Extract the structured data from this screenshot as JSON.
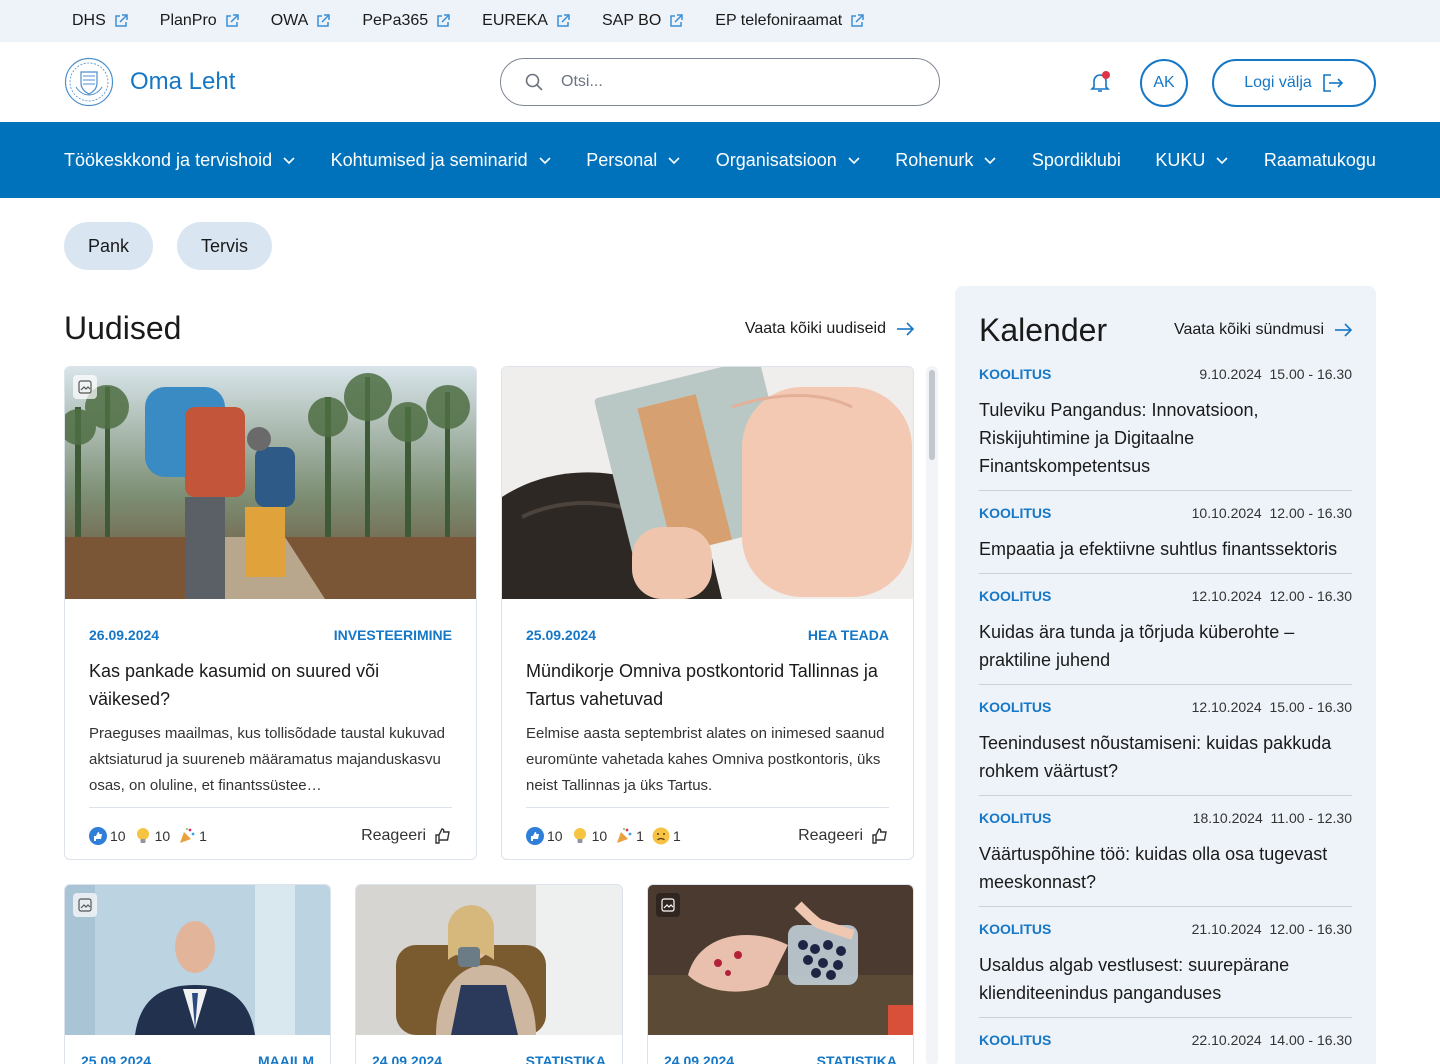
{
  "toplinks": [
    "DHS",
    "PlanPro",
    "OWA",
    "PePa365",
    "EUREKA",
    "SAP BO",
    "EP telefoniraamat"
  ],
  "header": {
    "brand": "Oma Leht",
    "search_placeholder": "Otsi...",
    "avatar_initials": "AK",
    "logout_label": "Logi välja"
  },
  "nav": [
    {
      "label": "Töökeskkond ja tervishoid",
      "dropdown": true
    },
    {
      "label": "Kohtumised ja seminarid",
      "dropdown": true
    },
    {
      "label": "Personal",
      "dropdown": true
    },
    {
      "label": "Organisatsioon",
      "dropdown": true
    },
    {
      "label": "Rohenurk",
      "dropdown": true
    },
    {
      "label": "Spordiklubi",
      "dropdown": false
    },
    {
      "label": "KUKU",
      "dropdown": true
    },
    {
      "label": "Raamatukogu",
      "dropdown": false
    }
  ],
  "chips": [
    "Pank",
    "Tervis"
  ],
  "news": {
    "title": "Uudised",
    "see_all": "Vaata kõiki uudiseid",
    "reply_label": "Reageeri",
    "cards": [
      {
        "date": "26.09.2024",
        "category": "INVESTEERIMINE",
        "title": "Kas pankade kasumid on suured või väikesed?",
        "text": "Praeguses maailmas, kus tollisõdade taustal kukuvad aktsiaturud ja suureneb määramatus majanduskasvu osas, on oluline, et finantssüstee…",
        "reactions": [
          {
            "icon": "thumbs-up-emoji",
            "count": "10"
          },
          {
            "icon": "lightbulb-emoji",
            "count": "10"
          },
          {
            "icon": "party-popper-emoji",
            "count": "1"
          }
        ]
      },
      {
        "date": "25.09.2024",
        "category": "HEA TEADA",
        "title": "Mündikorje Omniva postkontorid Tallinnas ja Tartus vahetuvad",
        "text": "Eelmise aasta septembrist alates on inimesed saanud euromünte vahetada kahes Omniva postkontoris, üks neist Tallinnas ja üks Tartus.",
        "reactions": [
          {
            "icon": "thumbs-up-emoji",
            "count": "10"
          },
          {
            "icon": "lightbulb-emoji",
            "count": "10"
          },
          {
            "icon": "party-popper-emoji",
            "count": "1"
          },
          {
            "icon": "sad-face-emoji",
            "count": "1"
          }
        ]
      },
      {
        "date": "25.09.2024",
        "category": "MAAILM"
      },
      {
        "date": "24.09.2024",
        "category": "STATISTIKA"
      },
      {
        "date": "24.09.2024",
        "category": "STATISTIKA"
      }
    ]
  },
  "calendar": {
    "title": "Kalender",
    "see_all": "Vaata kõiki sündmusi",
    "events": [
      {
        "tag": "KOOLITUS",
        "datetime": "9.10.2024  15.00 - 16.30",
        "title": "Tuleviku Pangandus: Innovatsioon, Riskijuhtimine ja Digitaalne Finantskompetentsus"
      },
      {
        "tag": "KOOLITUS",
        "datetime": "10.10.2024  12.00 - 16.30",
        "title": "Empaatia ja efektiivne suhtlus finantssektoris"
      },
      {
        "tag": "KOOLITUS",
        "datetime": "12.10.2024  12.00 - 16.30",
        "title": "Kuidas ära tunda ja tõrjuda küberohte – praktiline juhend"
      },
      {
        "tag": "KOOLITUS",
        "datetime": "12.10.2024  15.00 - 16.30",
        "title": "Teenindusest nõustamiseni: kuidas pakkuda rohkem väärtust?"
      },
      {
        "tag": "KOOLITUS",
        "datetime": "18.10.2024  11.00 - 12.30",
        "title": "Väärtuspõhine töö: kuidas olla osa tugevast meeskonnast?"
      },
      {
        "tag": "KOOLITUS",
        "datetime": "21.10.2024  12.00 - 16.30",
        "title": "Usaldus algab vestlusest: suurepärane klienditeenindus panganduses"
      },
      {
        "tag": "KOOLITUS",
        "datetime": "22.10.2024  14.00 - 16.30",
        "title": ""
      }
    ]
  },
  "colors": {
    "brand": "#1577c6",
    "nav_bg": "#0072bc",
    "panel_bg": "#eef3f9",
    "notification": "#e0334a"
  }
}
